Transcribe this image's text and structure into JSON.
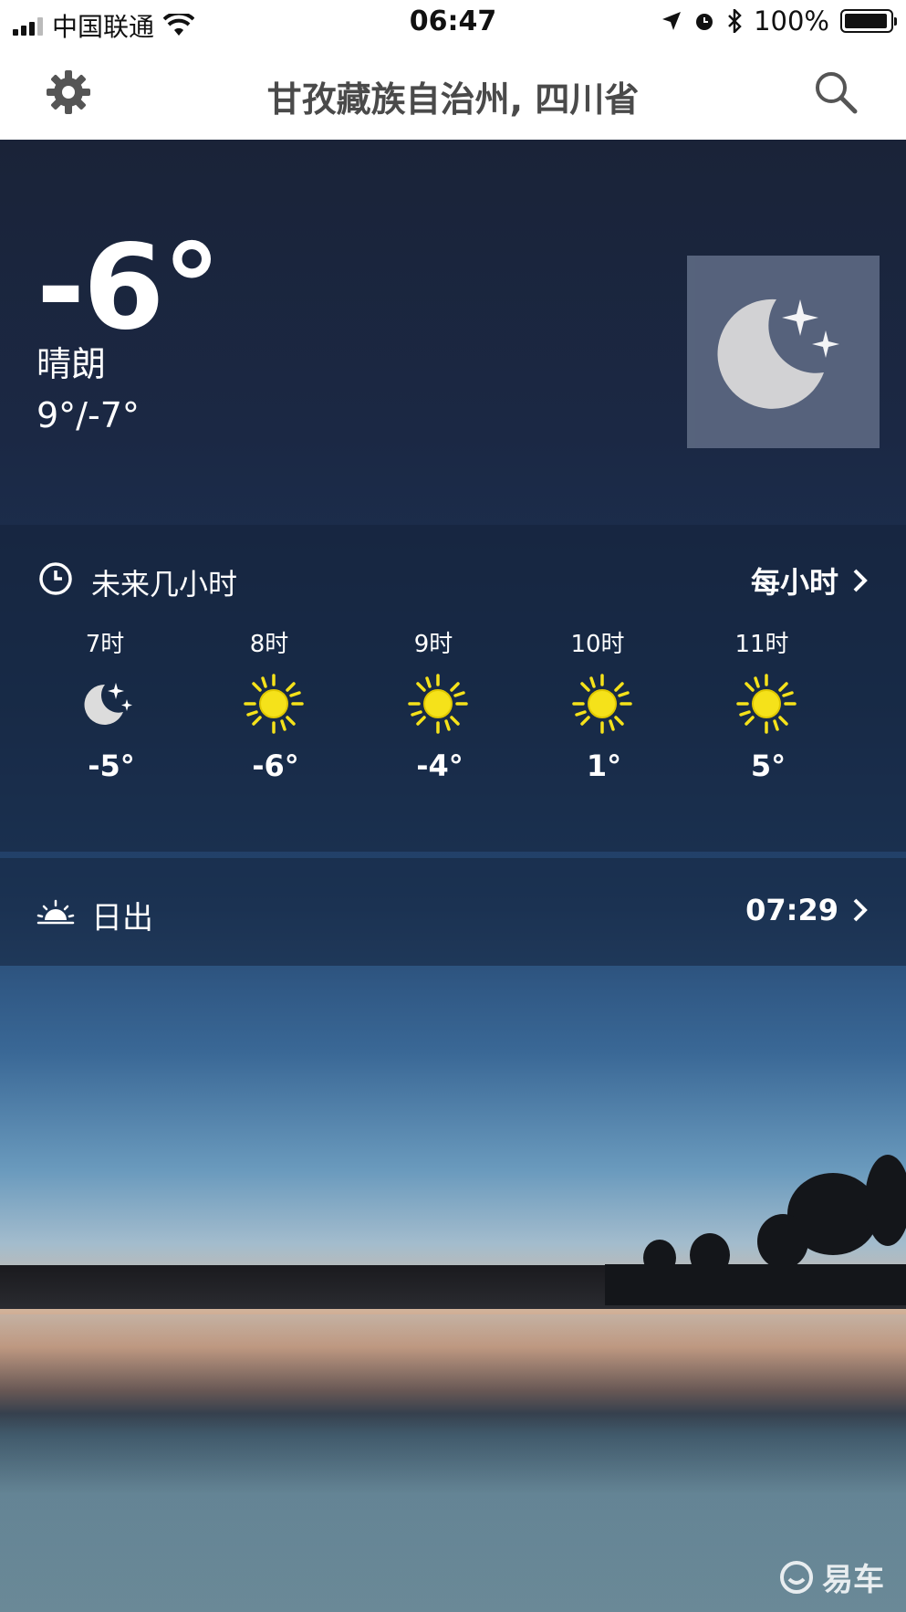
{
  "status_bar": {
    "carrier": "中国联通",
    "time": "06:47",
    "battery": "100%"
  },
  "header": {
    "location": "甘孜藏族自治州, 四川省"
  },
  "current": {
    "temperature": "-6°",
    "condition": "晴朗",
    "range": "9°/-7°",
    "icon": "moon-stars-icon"
  },
  "hourly": {
    "title": "未来几小时",
    "more_label": "每小时",
    "hours": [
      {
        "time": "7时",
        "icon": "moon-stars-icon",
        "temp": "-5°"
      },
      {
        "time": "8时",
        "icon": "sun-icon",
        "temp": "-6°"
      },
      {
        "time": "9时",
        "icon": "sun-icon",
        "temp": "-4°"
      },
      {
        "time": "10时",
        "icon": "sun-icon",
        "temp": "1°"
      },
      {
        "time": "11时",
        "icon": "sun-icon",
        "temp": "5°"
      }
    ]
  },
  "sunrise": {
    "label": "日出",
    "time": "07:29"
  },
  "watermark": {
    "text": "易车"
  },
  "colors": {
    "sun": "#f5e21a",
    "moon": "#dcdcdc",
    "panel": "#14223a"
  }
}
